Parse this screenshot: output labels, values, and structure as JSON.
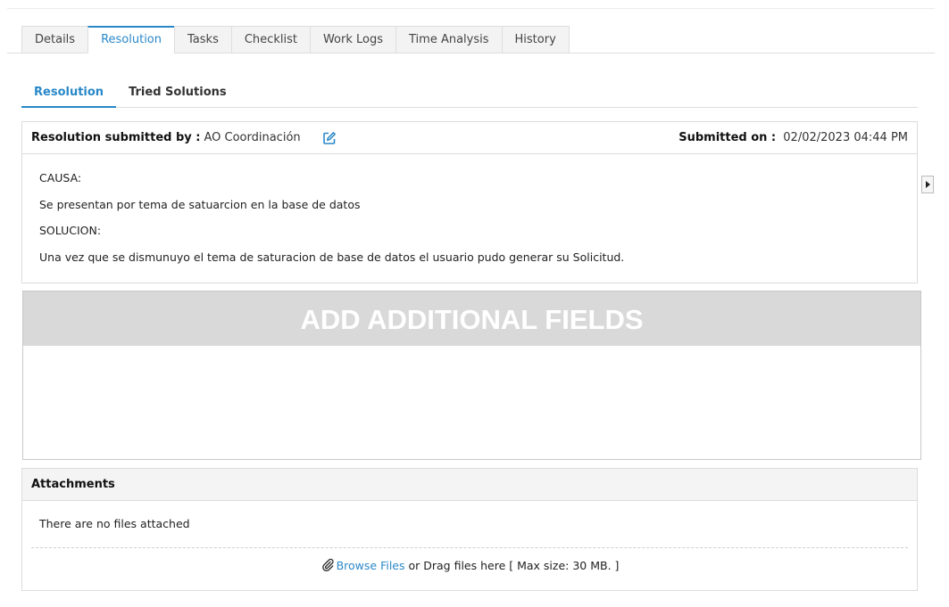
{
  "tabs": [
    "Details",
    "Resolution",
    "Tasks",
    "Checklist",
    "Work Logs",
    "Time Analysis",
    "History"
  ],
  "active_tab": "Resolution",
  "subtabs": [
    "Resolution",
    "Tried Solutions"
  ],
  "active_subtab": "Resolution",
  "resolution": {
    "submitted_by_label": "Resolution submitted by :",
    "submitted_by_value": "AO Coordinación",
    "submitted_on_label": "Submitted on :",
    "submitted_on_value": "02/02/2023 04:44 PM",
    "lines": [
      "CAUSA:",
      "Se presentan por tema de satuarcion en la base de datos",
      "SOLUCION:",
      "Una vez que se dismunuyo el tema de saturacion de base de datos el usuario pudo generar su Solicitud."
    ]
  },
  "additional_fields": {
    "banner": "ADD ADDITIONAL FIELDS"
  },
  "attachments": {
    "title": "Attachments",
    "empty_text": "There are no files attached",
    "browse_link": "Browse Files",
    "browse_suffix": " or Drag files here [ Max size: 30 MB. ]"
  },
  "icons": {
    "edit": "edit-icon",
    "attach": "paperclip-icon",
    "side": "caret-right-icon"
  },
  "colors": {
    "accent": "#2a88c9",
    "banner_bg": "#d9d9d9"
  }
}
